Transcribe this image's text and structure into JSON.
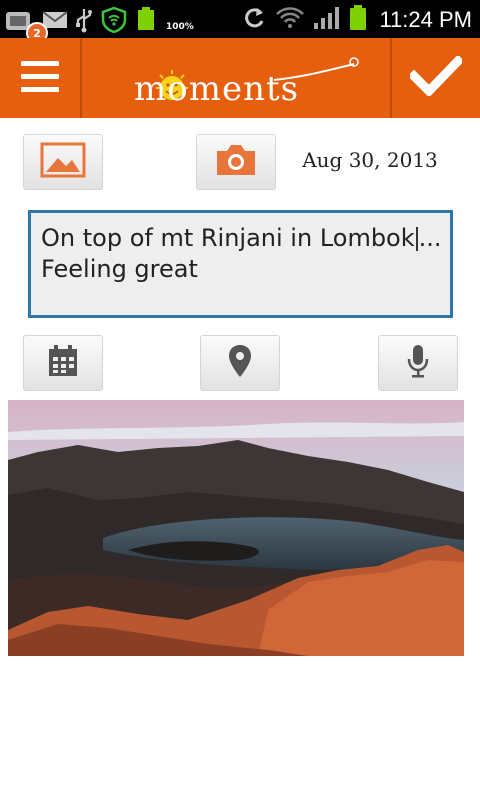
{
  "status_bar": {
    "notification_count": "2",
    "battery_percent": "100%",
    "time": "11:24 PM",
    "icons": [
      "gallery-notification-icon",
      "mail-icon",
      "usb-icon",
      "shield-icon",
      "battery-charging-icon",
      "sync-icon",
      "wifi-icon",
      "signal-icon",
      "battery-icon"
    ]
  },
  "action_bar": {
    "app_name": "moments",
    "menu_icon": "menu-icon",
    "confirm_icon": "checkmark-icon"
  },
  "entry": {
    "date": "Aug 30, 2013",
    "text_line1_before_caret": "On top of mt Rinjani in Lombok",
    "text_line1_after_caret": "...",
    "text_line2": "Feeling great"
  },
  "colors": {
    "accent": "#e55f0e",
    "input_border": "#2e78a8",
    "icon_orange": "#e8763a",
    "icon_gray": "#555555"
  }
}
